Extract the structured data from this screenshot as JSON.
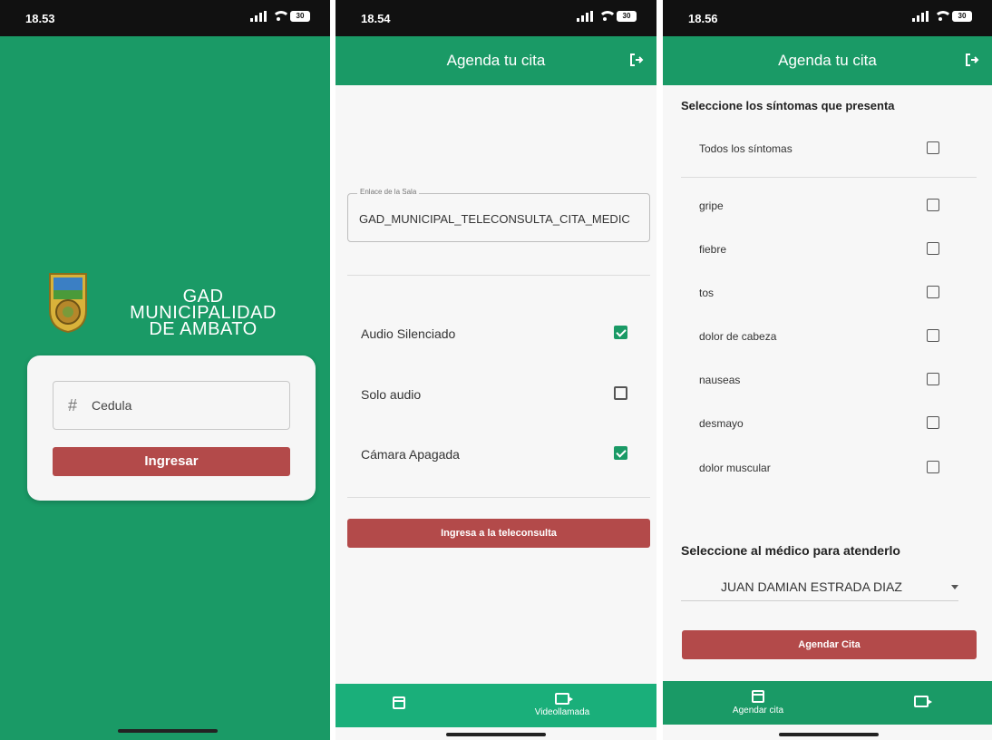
{
  "screen1": {
    "time": "18.53",
    "battery": "30",
    "brand_line1": "GAD MUNICIPALIDAD",
    "brand_line2": "DE AMBATO",
    "cedula_placeholder": "Cedula",
    "login_button": "Ingresar",
    "icons": {
      "field": "hash-icon",
      "logo": "municipal-shield-logo"
    }
  },
  "screen2": {
    "time": "18.54",
    "battery": "30",
    "title": "Agenda tu cita",
    "room_link_label": "Enlace de la Sala",
    "room_link_value": "GAD_MUNICIPAL_TELECONSULTA_CITA_MEDIC",
    "options": [
      {
        "label": "Audio Silenciado",
        "checked": true
      },
      {
        "label": "Solo audio",
        "checked": false
      },
      {
        "label": "Cámara Apagada",
        "checked": true
      }
    ],
    "join_button": "Ingresa a la teleconsulta",
    "nav": [
      {
        "label": "",
        "icon": "calendar-icon"
      },
      {
        "label": "Videollamada",
        "icon": "video-call-icon"
      }
    ]
  },
  "screen3": {
    "time": "18.56",
    "battery": "30",
    "title": "Agenda tu cita",
    "symptoms_title": "Seleccione los síntomas que presenta",
    "symptoms": [
      "Todos los síntomas",
      "gripe",
      "fiebre",
      "tos",
      "dolor de cabeza",
      "nauseas",
      "desmayo",
      "dolor muscular"
    ],
    "doctor_title": "Seleccione al médico para atenderlo",
    "doctor_selected": "JUAN DAMIAN ESTRADA DIAZ",
    "schedule_button": "Agendar Cita",
    "nav": [
      {
        "label": "Agendar cita",
        "icon": "calendar-icon"
      },
      {
        "label": "",
        "icon": "video-call-icon"
      }
    ]
  },
  "colors": {
    "primary": "#1a9a66",
    "nav": "#1aaf7a",
    "button": "#b34a4a"
  }
}
